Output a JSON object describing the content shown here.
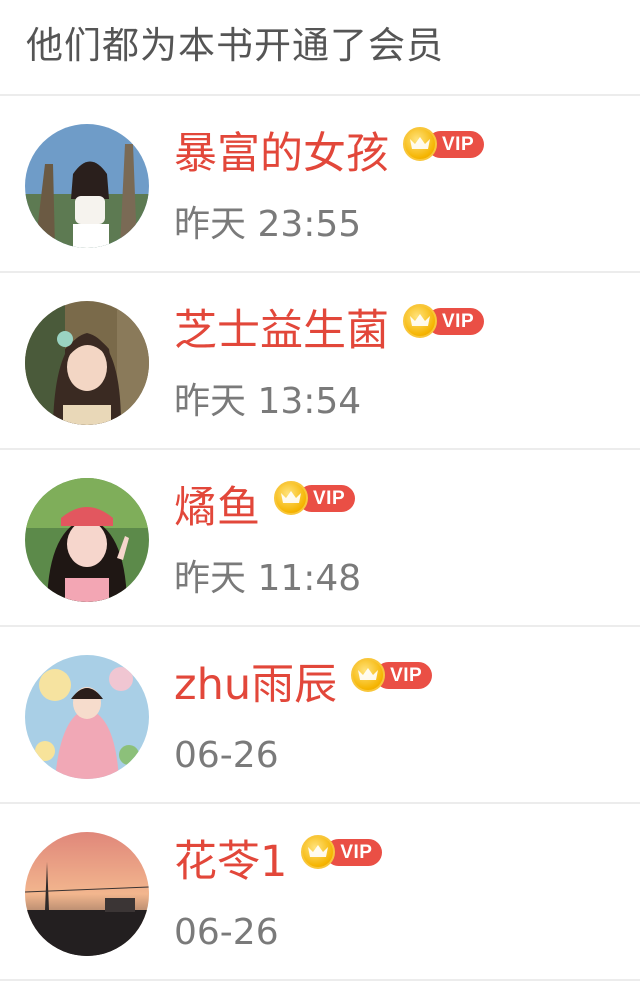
{
  "header": {
    "title": "他们都为本书开通了会员"
  },
  "vip_label": "VIP",
  "colors": {
    "name": "#e2473a",
    "vip_tag": "#ea4f45",
    "crown": "#f5b400",
    "time": "#7a7a7a",
    "divider": "#ececec"
  },
  "members": [
    {
      "name": "暴富的女孩",
      "time": "昨天 23:55",
      "vip": "VIP"
    },
    {
      "name": "芝士益生菌",
      "time": "昨天 13:54",
      "vip": "VIP"
    },
    {
      "name": "燏鱼",
      "time": "昨天 11:48",
      "vip": "VIP"
    },
    {
      "name": "zhu雨辰",
      "time": "06-26",
      "vip": "VIP"
    },
    {
      "name": "花苓1",
      "time": "06-26",
      "vip": "VIP"
    }
  ]
}
